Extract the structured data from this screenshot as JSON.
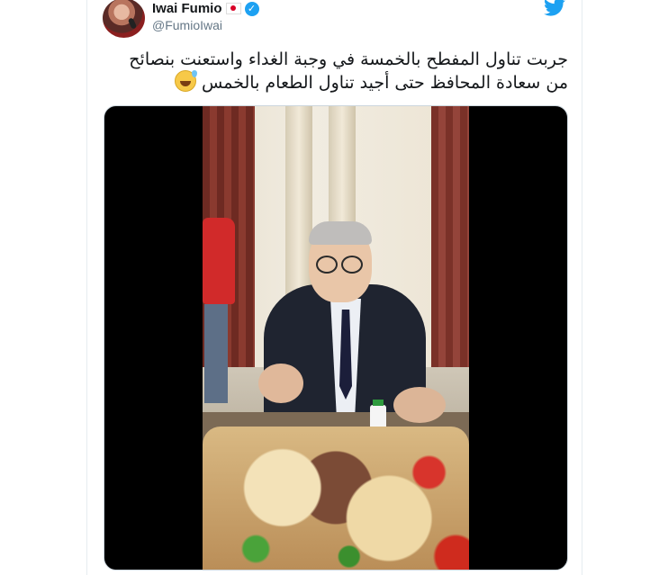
{
  "tweet": {
    "author_name": "Iwai Fumio",
    "handle": "@FumioIwai",
    "text_line1": "جربت تناول المفطح بالخمسة في وجبة الغداء واستعنت بنصائح",
    "text_line2": "من سعادة المحافظ حتى أجيد تناول  الطعام بالخمس",
    "icons": {
      "flag": "japan-flag-icon",
      "verified": "verified-badge-icon",
      "platform": "twitter-bird-icon",
      "emoji": "grinning-sweat-emoji-icon"
    }
  },
  "colors": {
    "twitter_blue": "#1da1f2",
    "text_primary": "#14171a",
    "text_secondary": "#657786"
  }
}
